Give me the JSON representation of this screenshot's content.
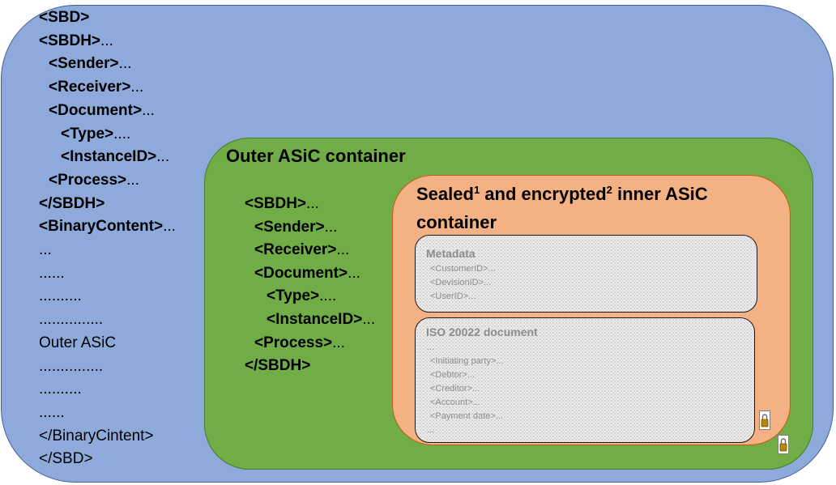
{
  "sbd_code": [
    {
      "tag": "<SBD>",
      "rest": ""
    },
    {
      "tag": "<SBDH>",
      "rest": "..."
    },
    {
      "tag": "<Sender>",
      "rest": "..."
    },
    {
      "tag": "<Receiver>",
      "rest": "..."
    },
    {
      "tag": "<Document>",
      "rest": "..."
    },
    {
      "tag": "<Type>",
      "rest": "...."
    },
    {
      "tag": "<InstanceID>",
      "rest": "..."
    },
    {
      "tag": "<Process>",
      "rest": "..."
    },
    {
      "tag": "</SBDH>",
      "rest": ""
    },
    {
      "tag": "<BinaryContent>",
      "rest": "..."
    },
    {
      "tag": "",
      "rest": "..."
    },
    {
      "tag": "",
      "rest": "......"
    },
    {
      "tag": "",
      "rest": ".........."
    },
    {
      "tag": "",
      "rest": "..............."
    },
    {
      "tag": "",
      "rest": "Outer ASiC"
    },
    {
      "tag": "",
      "rest": "..............."
    },
    {
      "tag": "",
      "rest": ".........."
    },
    {
      "tag": "",
      "rest": "......"
    },
    {
      "tag": "",
      "rest": "</BinaryCintent>"
    },
    {
      "tag": "",
      "rest": "</SBD>"
    }
  ],
  "outer_asic": {
    "title": "Outer ASiC container",
    "sbdh_code": [
      {
        "tag": "<SBDH>",
        "rest": "..."
      },
      {
        "tag": "<Sender>",
        "rest": "..."
      },
      {
        "tag": "<Receiver>",
        "rest": "..."
      },
      {
        "tag": "<Document>",
        "rest": "..."
      },
      {
        "tag": "<Type>",
        "rest": "...."
      },
      {
        "tag": "<InstanceID>",
        "rest": "..."
      },
      {
        "tag": "<Process>",
        "rest": "..."
      },
      {
        "tag": "</SBDH>",
        "rest": ""
      }
    ]
  },
  "inner_asic": {
    "title_part1": "Sealed",
    "sup1": "1",
    "title_part2": " and encrypted",
    "sup2": "2",
    "title_part3": " inner ASiC container",
    "metadata": {
      "title": "Metadata",
      "items": [
        "<CustomerID>...",
        "<DevisionID>...",
        "<UserID>..."
      ]
    },
    "iso_document": {
      "title": "ISO 20022 document",
      "items": [
        "...",
        "<Initiating party>...",
        "<Debtor>...",
        "<Creditor>...",
        "<Account>...",
        "<Payment date>...",
        "..."
      ]
    }
  },
  "icons": {
    "lock_inner": "lock-icon",
    "lock_outer": "lock-icon"
  },
  "colors": {
    "sbd_fill": "#8eaadb",
    "outer_asic_fill": "#70ad47",
    "inner_asic_fill": "#f4b183",
    "document_fill": "#ededed"
  }
}
